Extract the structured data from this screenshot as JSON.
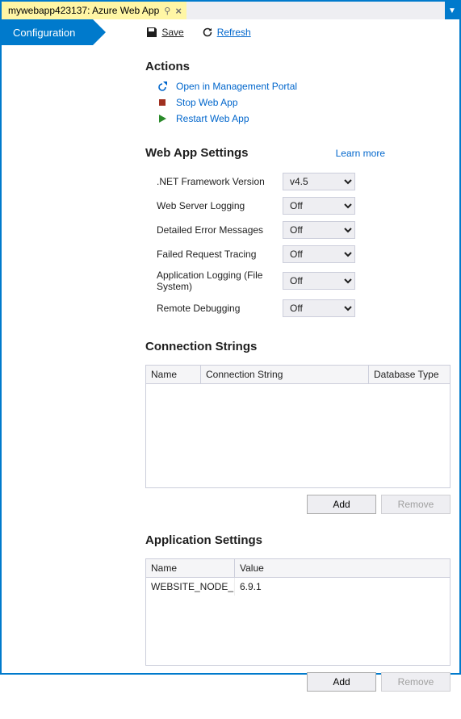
{
  "tab": {
    "title": "mywebapp423137: Azure Web App"
  },
  "nav": {
    "configuration": "Configuration",
    "save": "Save",
    "refresh": "Refresh"
  },
  "actions": {
    "title": "Actions",
    "open_portal": "Open in Management Portal",
    "stop": "Stop Web App",
    "restart": "Restart Web App"
  },
  "settings": {
    "title": "Web App Settings",
    "learn_more": "Learn more",
    "rows": {
      "net_label": ".NET Framework Version",
      "net_value": "v4.5",
      "logging_label": "Web Server Logging",
      "logging_value": "Off",
      "errors_label": "Detailed Error Messages",
      "errors_value": "Off",
      "tracing_label": "Failed Request Tracing",
      "tracing_value": "Off",
      "applog_label": "Application Logging (File System)",
      "applog_value": "Off",
      "remote_label": "Remote Debugging",
      "remote_value": "Off"
    }
  },
  "conn": {
    "title": "Connection Strings",
    "col_name": "Name",
    "col_conn": "Connection String",
    "col_type": "Database Type",
    "add": "Add",
    "remove": "Remove"
  },
  "app": {
    "title": "Application Settings",
    "col_name": "Name",
    "col_value": "Value",
    "rows": [
      {
        "name": "WEBSITE_NODE_DE",
        "value": "6.9.1"
      }
    ],
    "add": "Add",
    "remove": "Remove"
  }
}
